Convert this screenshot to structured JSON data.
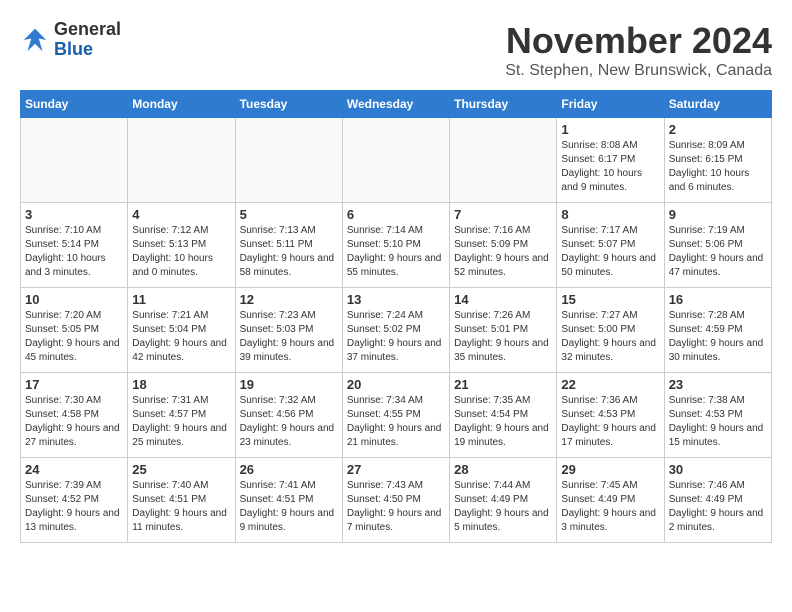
{
  "header": {
    "logo_general": "General",
    "logo_blue": "Blue",
    "title": "November 2024",
    "location": "St. Stephen, New Brunswick, Canada"
  },
  "calendar": {
    "days_of_week": [
      "Sunday",
      "Monday",
      "Tuesday",
      "Wednesday",
      "Thursday",
      "Friday",
      "Saturday"
    ],
    "weeks": [
      [
        {
          "day": "",
          "info": ""
        },
        {
          "day": "",
          "info": ""
        },
        {
          "day": "",
          "info": ""
        },
        {
          "day": "",
          "info": ""
        },
        {
          "day": "",
          "info": ""
        },
        {
          "day": "1",
          "info": "Sunrise: 8:08 AM\nSunset: 6:17 PM\nDaylight: 10 hours and 9 minutes."
        },
        {
          "day": "2",
          "info": "Sunrise: 8:09 AM\nSunset: 6:15 PM\nDaylight: 10 hours and 6 minutes."
        }
      ],
      [
        {
          "day": "3",
          "info": "Sunrise: 7:10 AM\nSunset: 5:14 PM\nDaylight: 10 hours and 3 minutes."
        },
        {
          "day": "4",
          "info": "Sunrise: 7:12 AM\nSunset: 5:13 PM\nDaylight: 10 hours and 0 minutes."
        },
        {
          "day": "5",
          "info": "Sunrise: 7:13 AM\nSunset: 5:11 PM\nDaylight: 9 hours and 58 minutes."
        },
        {
          "day": "6",
          "info": "Sunrise: 7:14 AM\nSunset: 5:10 PM\nDaylight: 9 hours and 55 minutes."
        },
        {
          "day": "7",
          "info": "Sunrise: 7:16 AM\nSunset: 5:09 PM\nDaylight: 9 hours and 52 minutes."
        },
        {
          "day": "8",
          "info": "Sunrise: 7:17 AM\nSunset: 5:07 PM\nDaylight: 9 hours and 50 minutes."
        },
        {
          "day": "9",
          "info": "Sunrise: 7:19 AM\nSunset: 5:06 PM\nDaylight: 9 hours and 47 minutes."
        }
      ],
      [
        {
          "day": "10",
          "info": "Sunrise: 7:20 AM\nSunset: 5:05 PM\nDaylight: 9 hours and 45 minutes."
        },
        {
          "day": "11",
          "info": "Sunrise: 7:21 AM\nSunset: 5:04 PM\nDaylight: 9 hours and 42 minutes."
        },
        {
          "day": "12",
          "info": "Sunrise: 7:23 AM\nSunset: 5:03 PM\nDaylight: 9 hours and 39 minutes."
        },
        {
          "day": "13",
          "info": "Sunrise: 7:24 AM\nSunset: 5:02 PM\nDaylight: 9 hours and 37 minutes."
        },
        {
          "day": "14",
          "info": "Sunrise: 7:26 AM\nSunset: 5:01 PM\nDaylight: 9 hours and 35 minutes."
        },
        {
          "day": "15",
          "info": "Sunrise: 7:27 AM\nSunset: 5:00 PM\nDaylight: 9 hours and 32 minutes."
        },
        {
          "day": "16",
          "info": "Sunrise: 7:28 AM\nSunset: 4:59 PM\nDaylight: 9 hours and 30 minutes."
        }
      ],
      [
        {
          "day": "17",
          "info": "Sunrise: 7:30 AM\nSunset: 4:58 PM\nDaylight: 9 hours and 27 minutes."
        },
        {
          "day": "18",
          "info": "Sunrise: 7:31 AM\nSunset: 4:57 PM\nDaylight: 9 hours and 25 minutes."
        },
        {
          "day": "19",
          "info": "Sunrise: 7:32 AM\nSunset: 4:56 PM\nDaylight: 9 hours and 23 minutes."
        },
        {
          "day": "20",
          "info": "Sunrise: 7:34 AM\nSunset: 4:55 PM\nDaylight: 9 hours and 21 minutes."
        },
        {
          "day": "21",
          "info": "Sunrise: 7:35 AM\nSunset: 4:54 PM\nDaylight: 9 hours and 19 minutes."
        },
        {
          "day": "22",
          "info": "Sunrise: 7:36 AM\nSunset: 4:53 PM\nDaylight: 9 hours and 17 minutes."
        },
        {
          "day": "23",
          "info": "Sunrise: 7:38 AM\nSunset: 4:53 PM\nDaylight: 9 hours and 15 minutes."
        }
      ],
      [
        {
          "day": "24",
          "info": "Sunrise: 7:39 AM\nSunset: 4:52 PM\nDaylight: 9 hours and 13 minutes."
        },
        {
          "day": "25",
          "info": "Sunrise: 7:40 AM\nSunset: 4:51 PM\nDaylight: 9 hours and 11 minutes."
        },
        {
          "day": "26",
          "info": "Sunrise: 7:41 AM\nSunset: 4:51 PM\nDaylight: 9 hours and 9 minutes."
        },
        {
          "day": "27",
          "info": "Sunrise: 7:43 AM\nSunset: 4:50 PM\nDaylight: 9 hours and 7 minutes."
        },
        {
          "day": "28",
          "info": "Sunrise: 7:44 AM\nSunset: 4:49 PM\nDaylight: 9 hours and 5 minutes."
        },
        {
          "day": "29",
          "info": "Sunrise: 7:45 AM\nSunset: 4:49 PM\nDaylight: 9 hours and 3 minutes."
        },
        {
          "day": "30",
          "info": "Sunrise: 7:46 AM\nSunset: 4:49 PM\nDaylight: 9 hours and 2 minutes."
        }
      ]
    ]
  }
}
